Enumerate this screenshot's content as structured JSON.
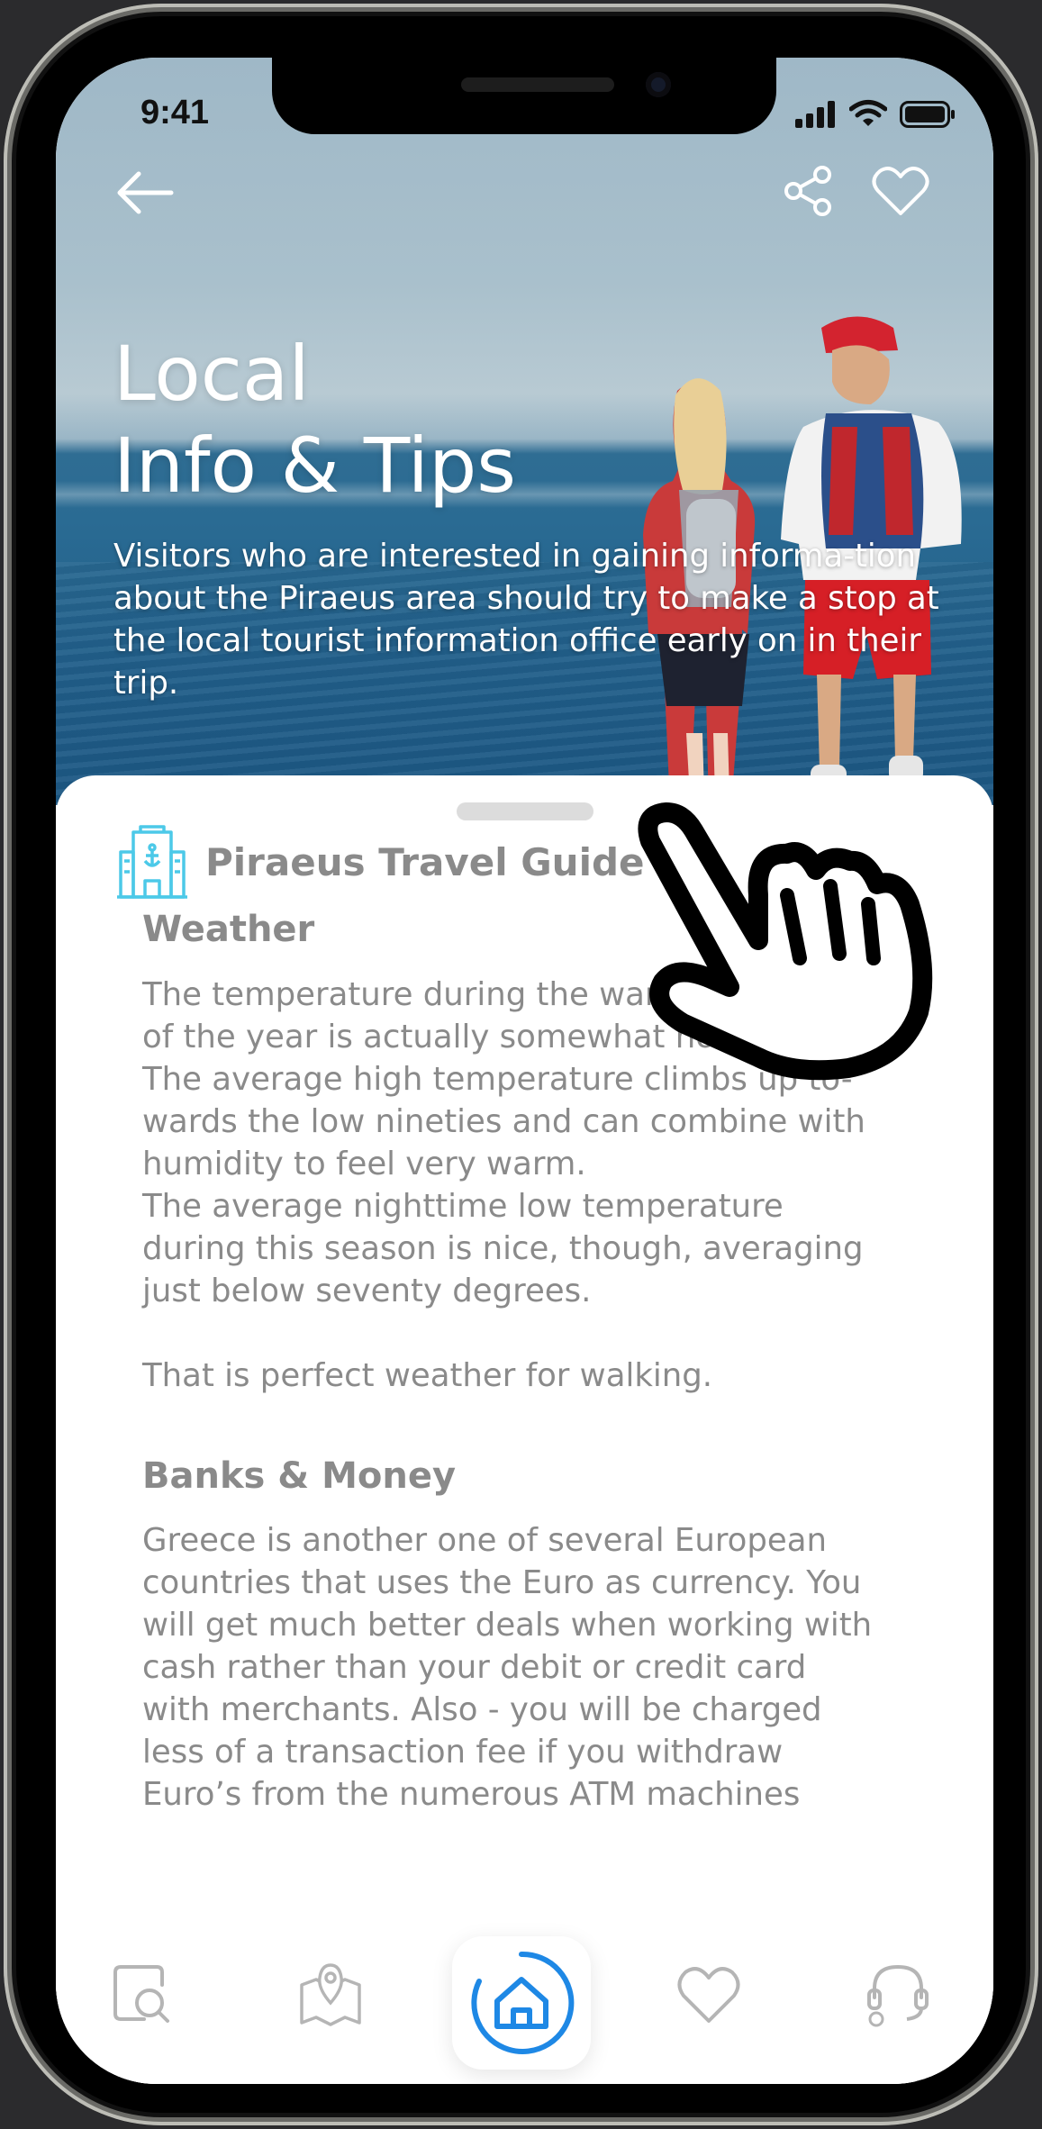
{
  "status_bar": {
    "time": "9:41"
  },
  "hero": {
    "title_line1": "Local",
    "title_line2": "Info & Tips",
    "description": "Visitors who are interested in gaining informa-tion about the Piraeus area should try to make a stop at the local tourist information office early on in their trip."
  },
  "header_actions": {
    "back_icon": "arrow-left-icon",
    "share_icon": "share-icon",
    "favorite_icon": "heart-outline-icon"
  },
  "guide": {
    "title": "Piraeus Travel Guide",
    "icon": "hotel-anchor-building-icon",
    "accent_color": "#4cc9e8"
  },
  "sections": [
    {
      "heading": "Weather",
      "body": "The temperature during the warmest months\nof the year is actually somewhat hot.\nThe average high temperature climbs up to-\nwards the low nineties and can combine with\nhumidity to feel very warm.\nThe average nighttime low temperature\nduring this season is nice, though, averaging\njust below seventy degrees.\n\nThat is perfect weather for walking."
    },
    {
      "heading": "Banks & Money",
      "body": " Greece is another one of several European\ncountries that uses the Euro as currency. You\nwill get much better deals when working with\ncash rather than your debit or credit card\nwith merchants.  Also - you will be charged\nless of a transaction fee if you withdraw\nEuro’s from the numerous ATM machines"
    }
  ],
  "tab_bar": {
    "active_color": "#1e88e5",
    "inactive_color": "#b5b5b5",
    "tabs": [
      {
        "icon": "search-document-icon",
        "active": false
      },
      {
        "icon": "map-pin-icon",
        "active": false
      },
      {
        "icon": "home-icon",
        "active": true
      },
      {
        "icon": "heart-icon",
        "active": false
      },
      {
        "icon": "support-headset-icon",
        "active": false
      }
    ]
  }
}
